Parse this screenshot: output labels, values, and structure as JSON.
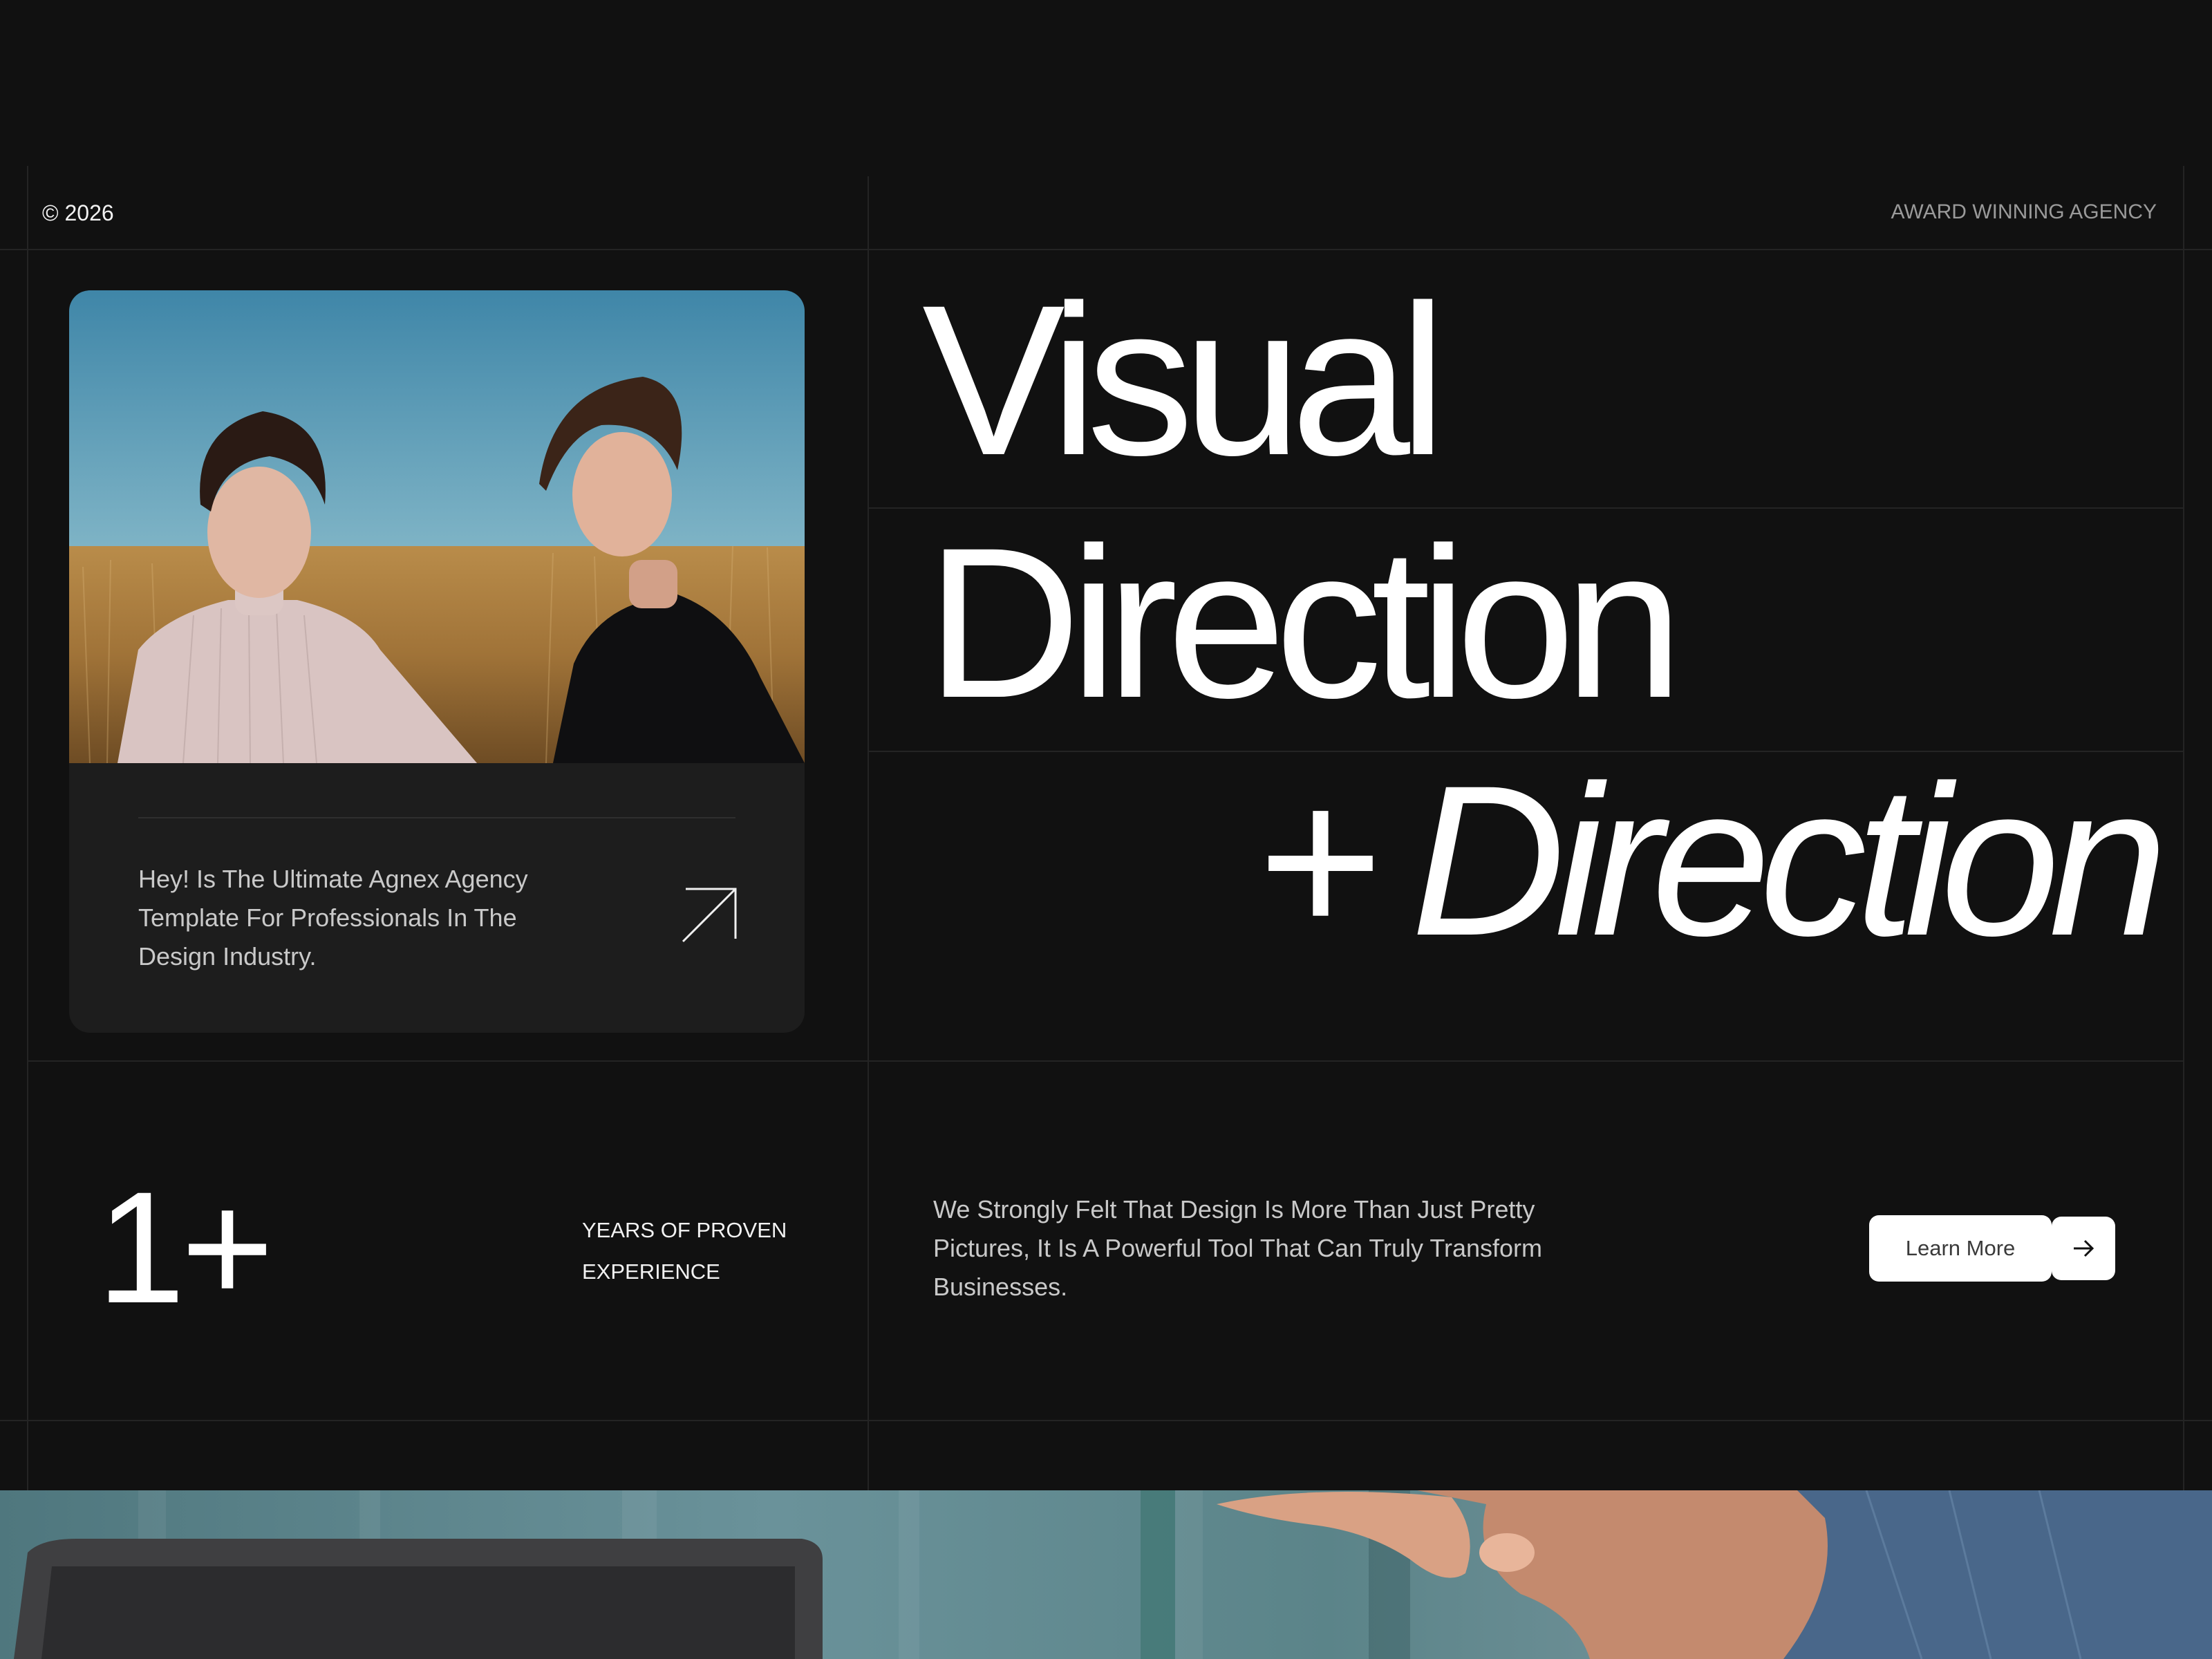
{
  "header": {
    "copyright": "© 2026",
    "tagline": "AWARD WINNING AGENCY"
  },
  "hero": {
    "image_alt": "Two young men standing in a golden grass field under a blue sky",
    "card_description": "Hey! Is The Ultimate Agnex Agency Template For Professionals In The Design Industry.",
    "card_arrow_icon": "arrow-up-right-icon",
    "headline": {
      "line1": "Visual",
      "line2": "Direction",
      "line3_prefix": "+",
      "line3_italic": "Direction"
    }
  },
  "stats": {
    "value": "1+",
    "label": "YEARS OF PROVEN EXPERIENCE"
  },
  "about": {
    "text": "We Strongly Felt That Design Is More Than Just Pretty Pictures, It Is A Powerful Tool That Can Truly Transform Businesses.",
    "cta_label": "Learn More",
    "cta_icon": "arrow-right-icon"
  },
  "colors": {
    "background": "#111111",
    "card": "#1d1d1d",
    "grid_line": "#242424",
    "text_primary": "#ffffff",
    "text_muted": "#c9c9c9",
    "button_bg": "#ffffff"
  }
}
